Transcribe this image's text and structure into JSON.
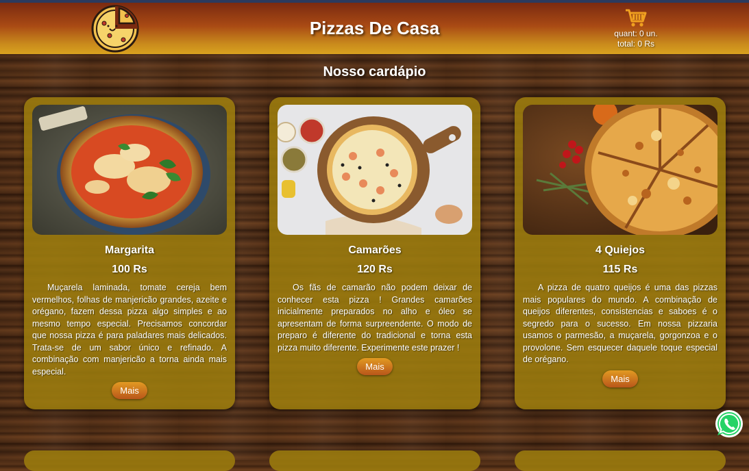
{
  "header": {
    "title": "Pizzas De Casa",
    "cart": {
      "quantity": "quant: 0 un.",
      "total": "total: 0 Rs"
    }
  },
  "menu": {
    "title": "Nosso cardápio",
    "items": [
      {
        "name": "Margarita",
        "price": "100 Rs",
        "description": "Muçarela laminada, tomate cereja bem vermelhos, folhas de manjericão grandes, azeite e orégano, fazem dessa pizza algo simples e ao mesmo tempo especial. Precisamos concordar que nossa pizza é para paladares mais delicados. Trata-se de um sabor único e refinado. A combinação com manjericão a torna ainda mais especial.",
        "button": "Mais",
        "image": "margherita-pizza-photo"
      },
      {
        "name": "Camarões",
        "price": "120 Rs",
        "description": "Os fãs de camarão não podem deixar de conhecer esta pizza ! Grandes camarões inicialmente preparados no alho e óleo se apresentam de forma surpreendente. O modo de preparo é diferente do tradicional e torna esta pizza muito diferente. Experimente este prazer !",
        "button": "Mais",
        "image": "shrimp-pizza-photo"
      },
      {
        "name": "4 Quiejos",
        "price": "115 Rs",
        "description": "A pizza de quatro queijos é uma das pizzas mais populares do mundo. A combinação de queijos diferentes, consistencias e saboes é o segredo para o sucesso. Em nossa pizzaria usamos o parmesão, a muçarela, gorgonzoa e o provolone. Sem esquecer daquele toque especial de orégano.",
        "button": "Mais",
        "image": "four-cheese-pizza-photo"
      }
    ]
  },
  "icons": {
    "logo": "pizza-logo-icon",
    "cart": "shopping-cart-icon",
    "whatsapp": "whatsapp-icon"
  },
  "colors": {
    "header_top": "#7a2a10",
    "header_bottom": "#d9a21f",
    "card": "#9c7c0e",
    "button": "#c8701c",
    "whatsapp": "#25d366"
  }
}
